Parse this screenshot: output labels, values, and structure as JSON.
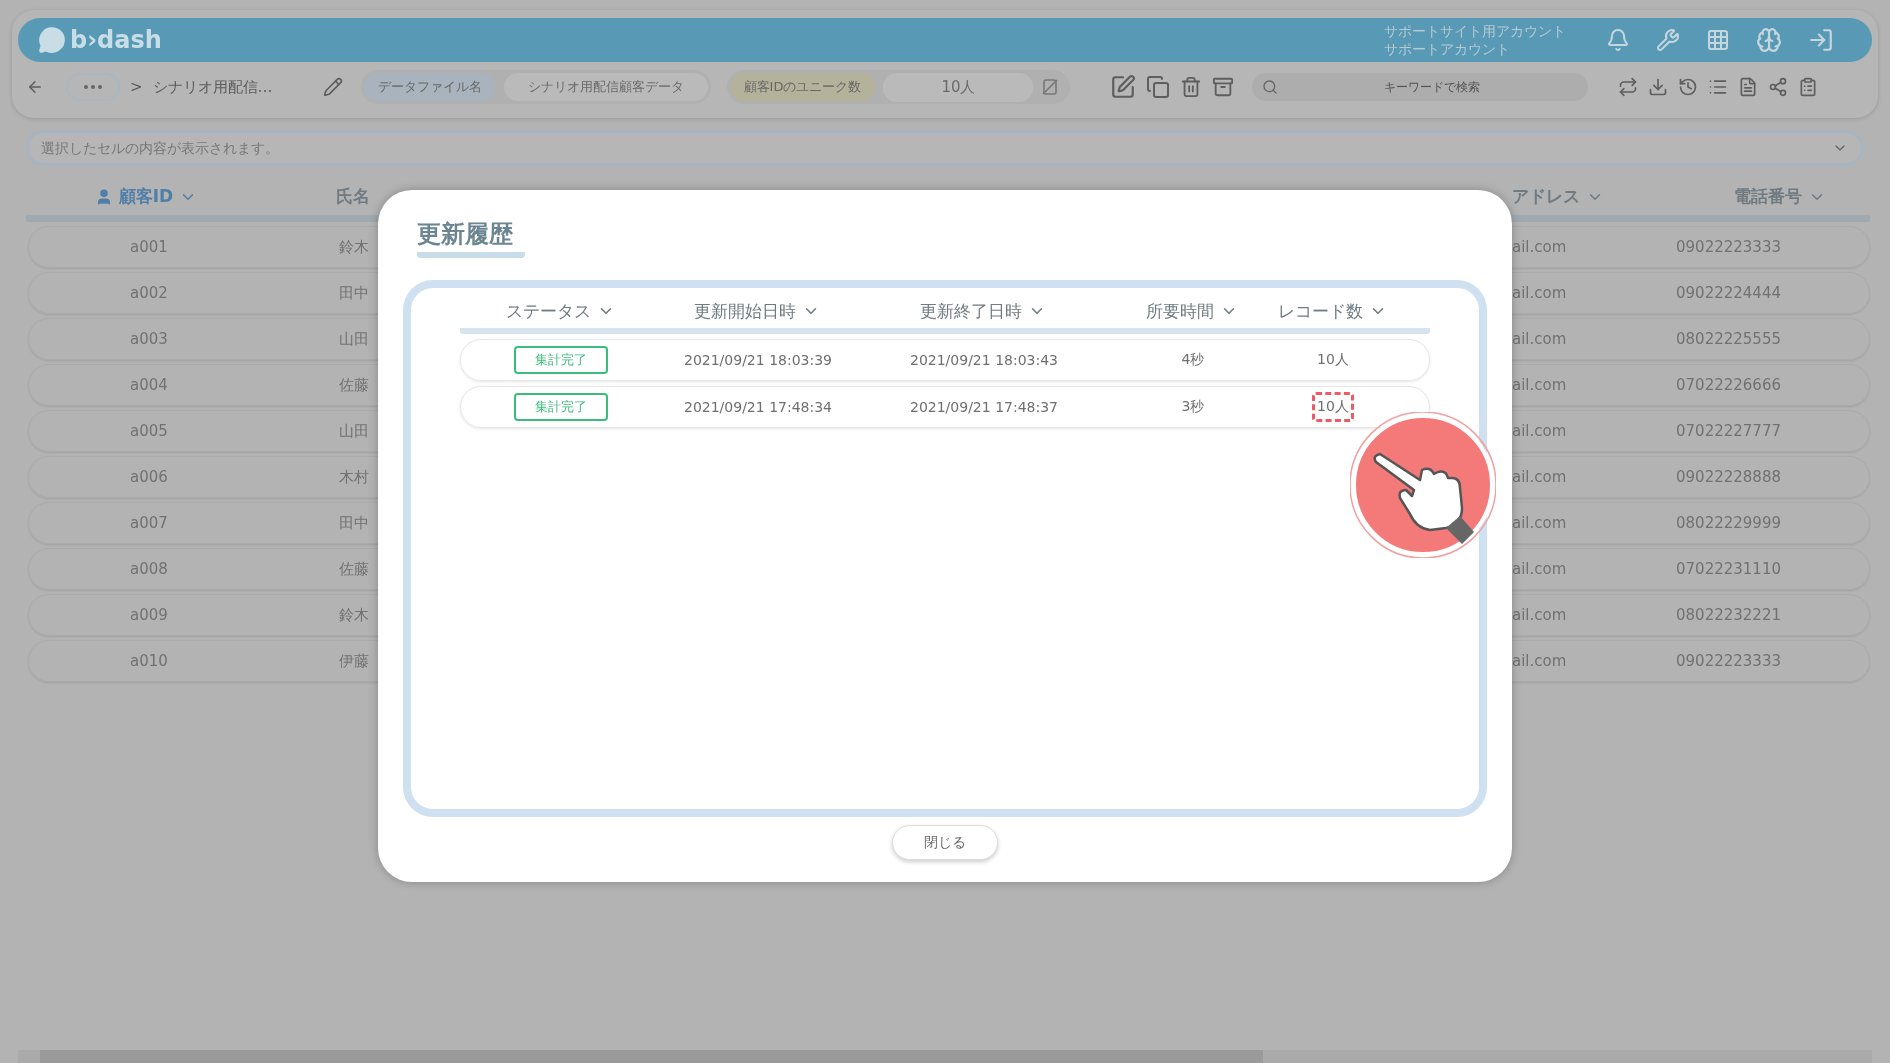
{
  "header": {
    "logo": "b›dash",
    "account_lines": [
      "サポートサイト用アカウント",
      "サポートアカウント"
    ]
  },
  "toolbar": {
    "breadcrumb_separator": ">",
    "breadcrumb": "シナリオ用配信…",
    "fields": [
      {
        "label": "データファイル名",
        "value": "シナリオ用配信顧客データ",
        "kind": "file"
      },
      {
        "label": "顧客IDのユニーク数",
        "value": "10人",
        "kind": "count"
      }
    ],
    "search": {
      "placeholder": "キーワードで検索"
    }
  },
  "cell_display": {
    "placeholder": "選択したセルの内容が表示されます。"
  },
  "table": {
    "columns": [
      {
        "label": "顧客ID",
        "kind": "key",
        "chevron": true
      },
      {
        "label": "氏名",
        "kind": "plain",
        "chevron": false
      },
      {
        "label": "アドレス",
        "kind": "plain",
        "chevron": true
      },
      {
        "label": "電話番号",
        "kind": "plain",
        "chevron": true
      }
    ],
    "rows": [
      {
        "id": "a001",
        "name": "鈴木",
        "email": "ail.com",
        "phone": "09022223333"
      },
      {
        "id": "a002",
        "name": "田中",
        "email": "ail.com",
        "phone": "09022224444"
      },
      {
        "id": "a003",
        "name": "山田",
        "email": "ail.com",
        "phone": "08022225555"
      },
      {
        "id": "a004",
        "name": "佐藤",
        "email": "ail.com",
        "phone": "07022226666"
      },
      {
        "id": "a005",
        "name": "山田",
        "email": "ail.com",
        "phone": "07022227777"
      },
      {
        "id": "a006",
        "name": "木村",
        "email": "ail.com",
        "phone": "09022228888"
      },
      {
        "id": "a007",
        "name": "田中",
        "email": "ail.com",
        "phone": "08022229999"
      },
      {
        "id": "a008",
        "name": "佐藤",
        "email": "ail.com",
        "phone": "07022231110"
      },
      {
        "id": "a009",
        "name": "鈴木",
        "email": "ail.com",
        "phone": "08022232221"
      },
      {
        "id": "a010",
        "name": "伊藤",
        "email": "ail.com",
        "phone": "09022223333"
      }
    ]
  },
  "modal": {
    "title": "更新履歴",
    "columns": [
      "ステータス",
      "更新開始日時",
      "更新終了日時",
      "所要時間",
      "レコード数"
    ],
    "rows": [
      {
        "status": "集計完了",
        "start": "2021/09/21 18:03:39",
        "end": "2021/09/21 18:03:43",
        "duration": "4秒",
        "records": "10人",
        "highlighted": false
      },
      {
        "status": "集計完了",
        "start": "2021/09/21 17:48:34",
        "end": "2021/09/21 17:48:37",
        "duration": "3秒",
        "records": "10人",
        "highlighted": true
      }
    ],
    "close_button": "閉じる"
  }
}
